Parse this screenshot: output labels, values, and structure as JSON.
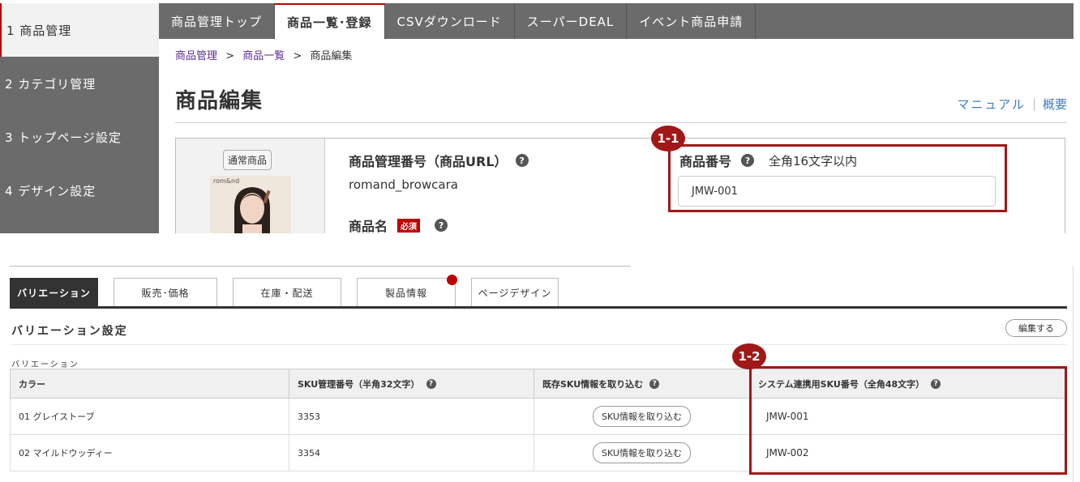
{
  "sidebar": {
    "items": [
      {
        "label": "1 商品管理"
      },
      {
        "label": "2 カテゴリ管理"
      },
      {
        "label": "3 トップページ設定"
      },
      {
        "label": "4 デザイン設定"
      }
    ]
  },
  "nav": {
    "tabs": [
      {
        "label": "商品管理トップ"
      },
      {
        "label": "商品一覧･登録"
      },
      {
        "label": "CSVダウンロード"
      },
      {
        "label": "スーパーDEAL"
      },
      {
        "label": "イベント商品申請"
      }
    ]
  },
  "breadcrumb": {
    "items": [
      "商品管理",
      "商品一覧",
      "商品編集"
    ],
    "sep": ">"
  },
  "page": {
    "title": "商品編集",
    "link_manual": "マニュアル",
    "link_overview": "概要"
  },
  "product": {
    "type_badge": "通常商品",
    "mgmt_label": "商品管理番号（商品URL）",
    "mgmt_value": "romand_browcara",
    "name_label": "商品名",
    "required": "必須",
    "number_label": "商品番号",
    "number_hint": "全角16文字以内",
    "number_value": "JMW-001",
    "photo_logo": "rom&nd"
  },
  "annotations": {
    "a1": "1-1",
    "a2": "1-2"
  },
  "subtabs": [
    "バリエーション",
    "販売･価格",
    "在庫・配送",
    "製品情報",
    "ページデザイン"
  ],
  "section": {
    "title": "バリエーション設定",
    "edit": "編集する",
    "var_label": "バリエーション"
  },
  "table": {
    "headers": [
      "カラー",
      "SKU管理番号（半角32文字）",
      "既存SKU情報を取り込む",
      "システム連携用SKU番号（全角48文字）"
    ],
    "rows": [
      {
        "color": "01 グレイストーブ",
        "sku": "3353",
        "import_btn": "SKU情報を取り込む",
        "sys_sku": "JMW-001"
      },
      {
        "color": "02 マイルドウッディー",
        "sku": "3354",
        "import_btn": "SKU情報を取り込む",
        "sys_sku": "JMW-002"
      }
    ]
  },
  "colors": {
    "accent_red": "#a01818",
    "nav_gray": "#6b6b6b",
    "link_blue": "#3f7bc1"
  }
}
